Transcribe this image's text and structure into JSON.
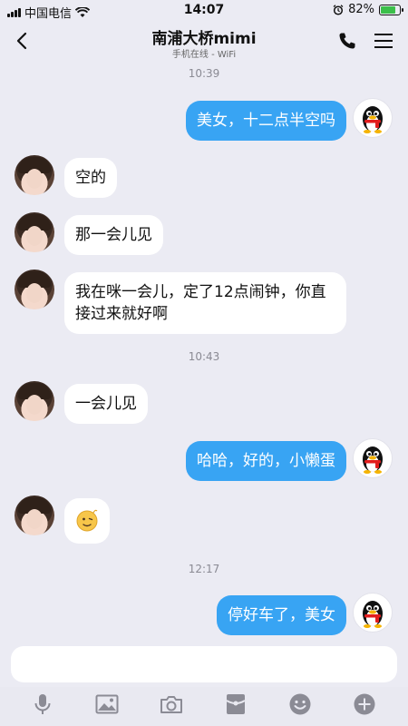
{
  "status_bar": {
    "carrier": "中国电信",
    "time": "14:07",
    "battery_percent": "82%",
    "battery_level": 0.82
  },
  "nav": {
    "title": "南浦大桥mimi",
    "subtitle": "手机在线 - WiFi"
  },
  "timestamps": [
    "10:39",
    "10:43",
    "12:17"
  ],
  "messages": [
    {
      "from": "me",
      "text": "美女，十二点半空吗"
    },
    {
      "from": "other",
      "text": "空的"
    },
    {
      "from": "other",
      "text": "那一会儿见"
    },
    {
      "from": "other",
      "text": "我在咪一会儿，定了12点闹钟，你直接过来就好啊"
    },
    {
      "from": "other",
      "text": "一会儿见"
    },
    {
      "from": "me",
      "text": "哈哈，好的，小懒蛋"
    },
    {
      "from": "other",
      "emoji": "face-emoji"
    },
    {
      "from": "me",
      "text": "停好车了，美女"
    }
  ],
  "input": {
    "value": ""
  },
  "colors": {
    "background": "#ebebf3",
    "my_bubble": "#38a4f3",
    "other_bubble": "#ffffff",
    "icon_gray": "#8b8b95"
  }
}
